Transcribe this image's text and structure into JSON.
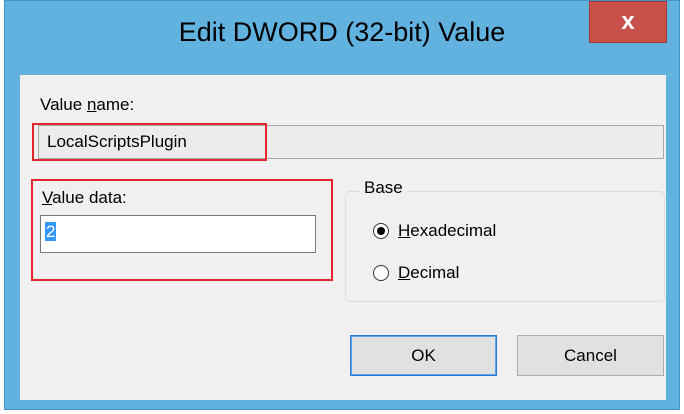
{
  "dialog": {
    "title": "Edit DWORD (32-bit) Value",
    "close_glyph": "x",
    "value_name": {
      "label_prefix": "Value ",
      "label_mnemonic": "n",
      "label_suffix": "ame:",
      "value": "LocalScriptsPlugin"
    },
    "value_data": {
      "label_mnemonic": "V",
      "label_suffix": "alue data:",
      "value": "2"
    },
    "base": {
      "label": "Base",
      "options": [
        {
          "mnemonic": "H",
          "rest": "exadecimal",
          "selected": true
        },
        {
          "mnemonic": "D",
          "rest": "ecimal",
          "selected": false
        }
      ]
    },
    "buttons": {
      "ok": "OK",
      "cancel": "Cancel"
    }
  },
  "colors": {
    "frame": "#61b2df",
    "close": "#c7504a",
    "highlight": "#e2262b",
    "selection": "#3399ff"
  },
  "icons": {
    "close": "close-icon",
    "radio_on": "radio-selected-icon",
    "radio_off": "radio-unselected-icon"
  }
}
